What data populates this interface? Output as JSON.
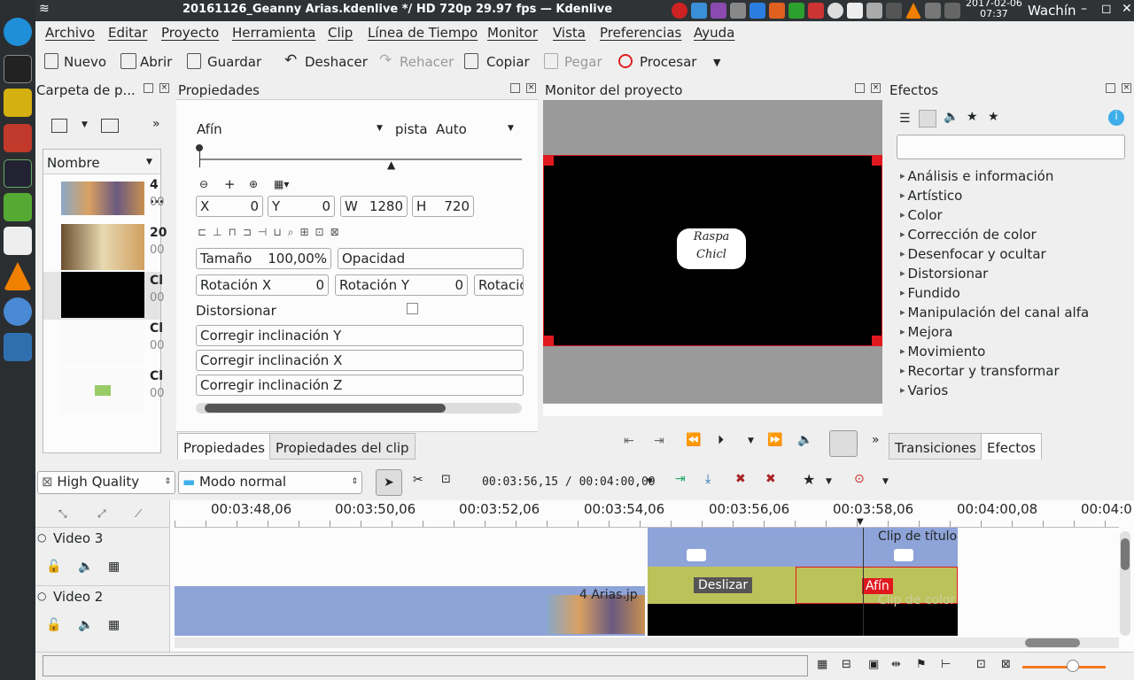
{
  "window": {
    "title": "20161126_Geanny Arias.kdenlive */ HD 720p 29.97 fps — Kdenlive",
    "clock_date": "2017-02-06",
    "clock_time": "07:37",
    "user": "Wachín"
  },
  "menu": [
    "Archivo",
    "Editar",
    "Proyecto",
    "Herramienta",
    "Clip",
    "Línea de Tiempo",
    "Monitor",
    "Vista",
    "Preferencias",
    "Ayuda"
  ],
  "toolbar": {
    "new": "Nuevo",
    "open": "Abrir",
    "save": "Guardar",
    "undo": "Deshacer",
    "redo": "Rehacer",
    "copy": "Copiar",
    "paste": "Pegar",
    "render": "Procesar"
  },
  "bin": {
    "title": "Carpeta de p...",
    "column": "Nombre",
    "items": [
      {
        "name": "4 ...",
        "dur": "00"
      },
      {
        "name": "20",
        "dur": "00"
      },
      {
        "name": "Cl",
        "dur": "00"
      },
      {
        "name": "Cl",
        "dur": "00"
      },
      {
        "name": "Cl",
        "dur": "00"
      }
    ]
  },
  "props": {
    "title": "Propiedades",
    "effect": "Afín",
    "track_label": "pista",
    "track_value": "Auto",
    "x_label": "X",
    "x": "0",
    "y_label": "Y",
    "y": "0",
    "w_label": "W",
    "w": "1280",
    "h_label": "H",
    "h": "720",
    "size_label": "Tamaño",
    "size": "100,00%",
    "opacity_label": "Opacidad",
    "rotx_label": "Rotación X",
    "rotx": "0",
    "roty_label": "Rotación Y",
    "roty": "0",
    "rotz_label": "Rotacio",
    "distort_label": "Distorsionar",
    "skewy": "Corregir inclinación Y",
    "skewx": "Corregir inclinación X",
    "skewz": "Corregir inclinación Z",
    "tab1": "Propiedades",
    "tab2": "Propiedades del clip"
  },
  "monitor": {
    "title": "Monitor del proyecto",
    "logo_text": "Raspa Chicl"
  },
  "effects": {
    "title": "Efectos",
    "categories": [
      "Análisis e información",
      "Artístico",
      "Color",
      "Corrección de color",
      "Desenfocar y ocultar",
      "Distorsionar",
      "Fundido",
      "Manipulación del canal alfa",
      "Mejora",
      "Movimiento",
      "Recortar y transformar",
      "Varios"
    ],
    "tab1": "Transiciones",
    "tab2": "Efectos"
  },
  "timeline": {
    "quality": "High Quality",
    "mode": "Modo normal",
    "timecode": "00:03:56,15 / 00:04:00,09",
    "ticks": [
      "00:03:48,06",
      "00:03:50,06",
      "00:03:52,06",
      "00:03:54,06",
      "00:03:56,06",
      "00:03:58,06",
      "00:04:00,08",
      "00:04:0"
    ],
    "tracks": [
      "Video 3",
      "Video 2"
    ],
    "clip_title": "Clip de título",
    "clip_image": "4 Arias.jp",
    "clip_color": "Clip de color",
    "trans_slide": "Deslizar",
    "trans_affine": "Afín"
  },
  "colors": {
    "accent": "#3daee9",
    "clip_blue": "#8ea3d8",
    "transition_green": "#bcc25a",
    "selected_red": "#e0191e",
    "dark": "#2b2e31"
  }
}
